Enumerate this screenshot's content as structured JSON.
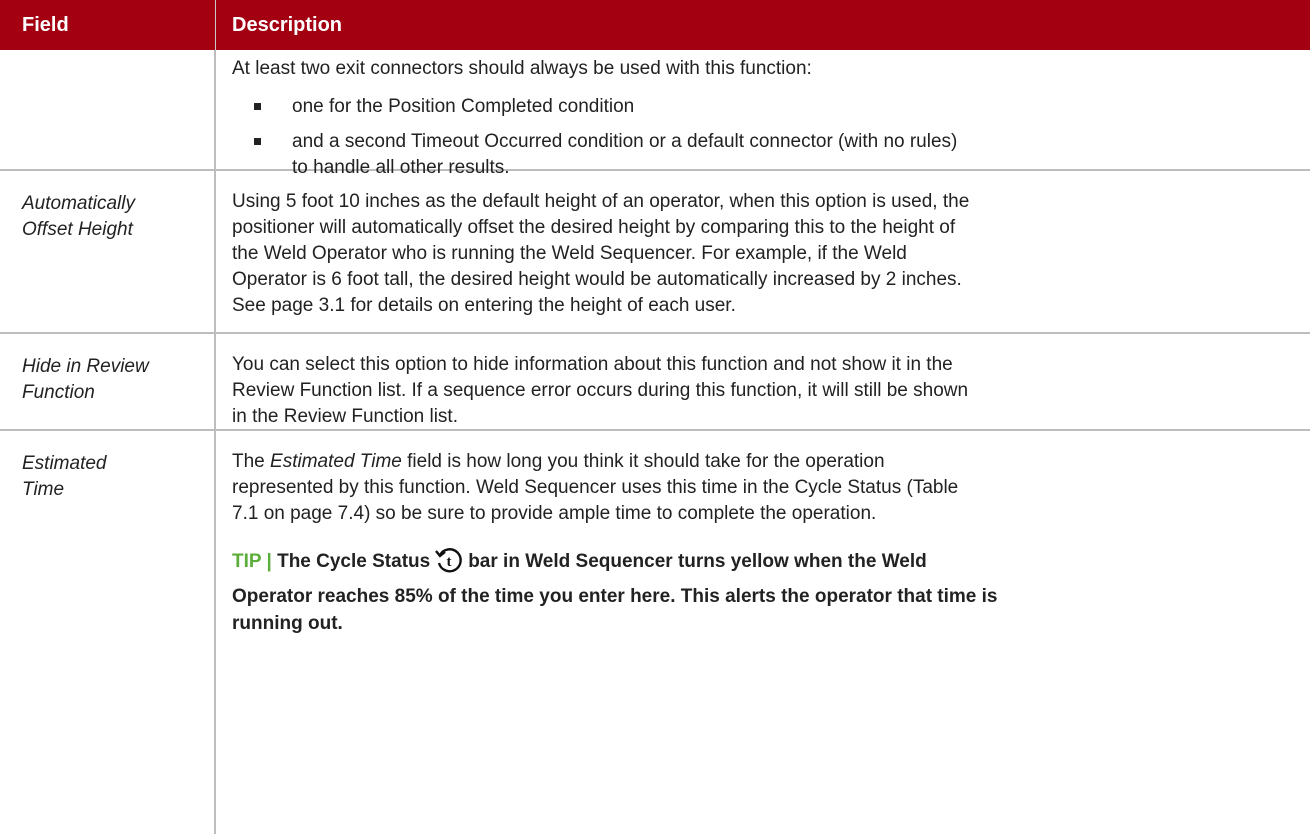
{
  "header": {
    "field": "Field",
    "description": "Description"
  },
  "rows": [
    {
      "field": "",
      "intro": "At least two exit connectors should always be used with this function:",
      "bullets": [
        "one for the Position Completed condition",
        "and a second Timeout Occurred condition or a default connector (with no rules)",
        "to handle all other results."
      ]
    },
    {
      "field": [
        "Automatically",
        "Offset Height"
      ],
      "lines": [
        "Using 5 foot 10 inches as the default height of an operator, when this option is used, the",
        "positioner will automatically offset the desired height by comparing this to the height of",
        "the Weld Operator who is running the Weld Sequencer.  For example, if the Weld",
        "Operator is 6 foot tall, the desired height would be automatically increased by 2 inches.",
        "See page 3.1 for details on entering the height of each user."
      ]
    },
    {
      "field": [
        "Hide in Review",
        "Function"
      ],
      "lines": [
        "You can select this option to hide information about this function and not show it in the",
        "Review Function list.  If a sequence error occurs during this function, it will still be shown",
        "in the Review Function list."
      ]
    },
    {
      "field": [
        "Estimated",
        "Time"
      ],
      "line1_pre": "The ",
      "line1_em": "Estimated Time",
      "line1_post": " field is how long you think it should take for the operation",
      "lines": [
        "represented by this function.  Weld Sequencer uses this time in the Cycle Status (Table",
        "7.1 on page 7.4) so be sure to provide ample time to complete the operation."
      ],
      "tip_label": "TIP  |",
      "tip_pre": " The Cycle Status",
      "tip_icon": "cycle-timer-icon",
      "tip_post": "bar in Weld Sequencer turns yellow when the Weld",
      "tip_lines": [
        "Operator reaches 85% of the time you enter here.  This alerts the operator that time is",
        "running out."
      ]
    }
  ],
  "colors": {
    "header_bg": "#a30012",
    "tip_label": "#5cae3a",
    "border": "#bdbdbd"
  }
}
